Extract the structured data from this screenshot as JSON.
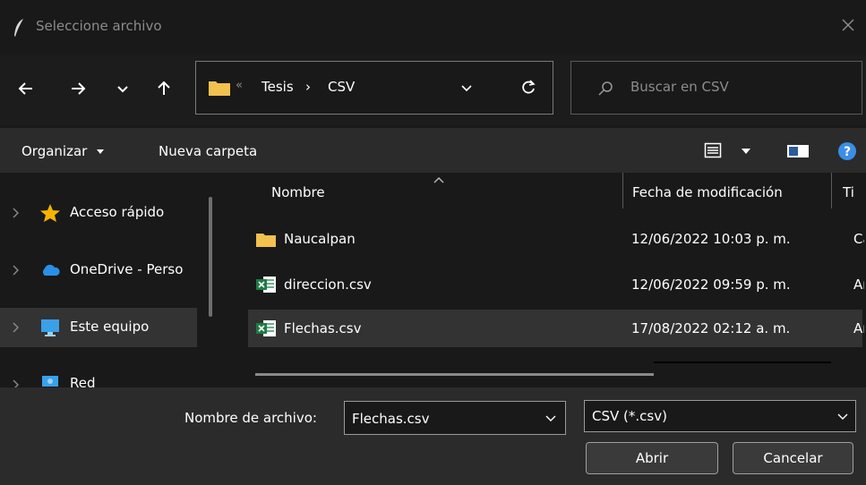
{
  "window": {
    "title": "Seleccione archivo"
  },
  "address": {
    "overflow": "«",
    "crumbs": [
      "Tesis",
      "CSV"
    ],
    "separator": "›"
  },
  "search": {
    "placeholder": "Buscar en CSV"
  },
  "toolbar": {
    "organize": "Organizar",
    "new_folder": "Nueva carpeta"
  },
  "sidebar": {
    "items": [
      {
        "label": "Acceso rápido",
        "icon": "star-icon"
      },
      {
        "label": "OneDrive - Perso",
        "icon": "cloud-icon"
      },
      {
        "label": "Este equipo",
        "icon": "computer-icon",
        "selected": true
      },
      {
        "label": "Red",
        "icon": "network-icon"
      }
    ]
  },
  "columns": {
    "name": "Nombre",
    "date": "Fecha de modificación",
    "type": "Ti"
  },
  "files": [
    {
      "name": "Naucalpan",
      "date": "12/06/2022 10:03 p. m.",
      "type": "Ca",
      "icon": "folder-icon"
    },
    {
      "name": "direccion.csv",
      "date": "12/06/2022 09:59 p. m.",
      "type": "Ar",
      "icon": "excel-csv-icon"
    },
    {
      "name": "Flechas.csv",
      "date": "17/08/2022 02:12 a. m.",
      "type": "Ar",
      "icon": "excel-csv-icon",
      "selected": true
    }
  ],
  "bottom": {
    "filename_label": "Nombre de archivo:",
    "filename_value": "Flechas.csv",
    "filetype_value": "CSV (*.csv)",
    "open": "Abrir",
    "cancel": "Cancelar"
  },
  "colors": {
    "folder": "#f2c14e",
    "excel_green": "#1e7b45",
    "help_blue": "#3a8ee6",
    "star": "#f5b400",
    "cloud": "#2b8fe6"
  }
}
